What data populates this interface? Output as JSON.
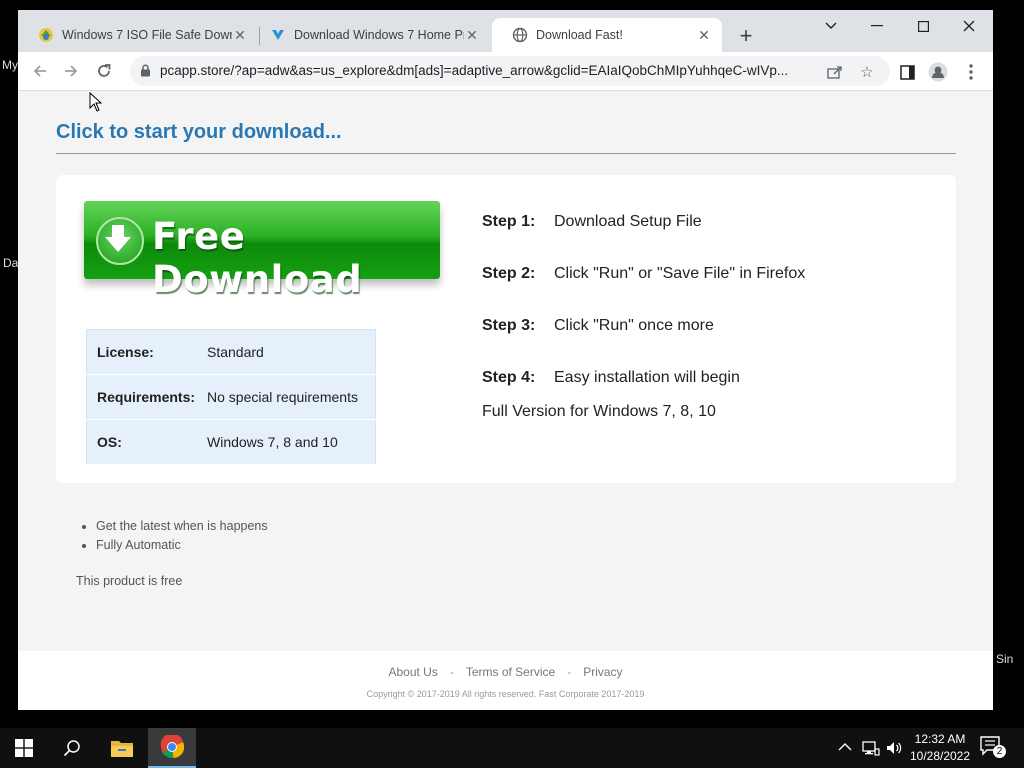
{
  "desktop": {
    "fragments": [
      "My",
      "Da",
      "Sin"
    ]
  },
  "browser": {
    "tabs": [
      {
        "title": "Windows 7 ISO File Safe Downl",
        "favicon": "windows-iso-icon",
        "active": false
      },
      {
        "title": "Download Windows 7 Home Pr",
        "favicon": "download-arrow-icon",
        "active": false
      },
      {
        "title": "Download Fast!",
        "favicon": "globe-icon",
        "active": true
      }
    ],
    "new_tab_label": "+",
    "address": "pcapp.store/?ap=adw&as=us_explore&dm[ads]=adaptive_arrow&gclid=EAIaIQobChMIpYuhhqeC-wIVp..."
  },
  "page": {
    "heading": "Click to start your download...",
    "download_button_label": "Free Download",
    "info": [
      {
        "key": "License:",
        "value": "Standard"
      },
      {
        "key": "Requirements:",
        "value": "No special requirements"
      },
      {
        "key": "OS:",
        "value": "Windows 7, 8 and 10"
      }
    ],
    "steps": [
      {
        "label": "Step 1:",
        "text": "Download Setup File"
      },
      {
        "label": "Step 2:",
        "text": "Click \"Run\" or \"Save File\" in Firefox"
      },
      {
        "label": "Step 3:",
        "text": "Click \"Run\" once more"
      },
      {
        "label": "Step 4:",
        "text": "Easy installation will begin"
      }
    ],
    "full_version": "Full Version for Windows 7, 8, 10",
    "features": [
      "Get the latest when is happens",
      "Fully Automatic"
    ],
    "free_note": "This product is free",
    "footer": {
      "links": [
        "About Us",
        "Terms of Service",
        "Privacy"
      ],
      "separator": "-",
      "copyright": "Copyright © 2017-2019 All rights reserved. Fast Corporate 2017-2019"
    }
  },
  "taskbar": {
    "time": "12:32 AM",
    "date": "10/28/2022",
    "notification_count": "2"
  },
  "colors": {
    "heading": "#2a78b3",
    "button_green": "#2bb024",
    "info_bg": "#e6f0fa"
  }
}
